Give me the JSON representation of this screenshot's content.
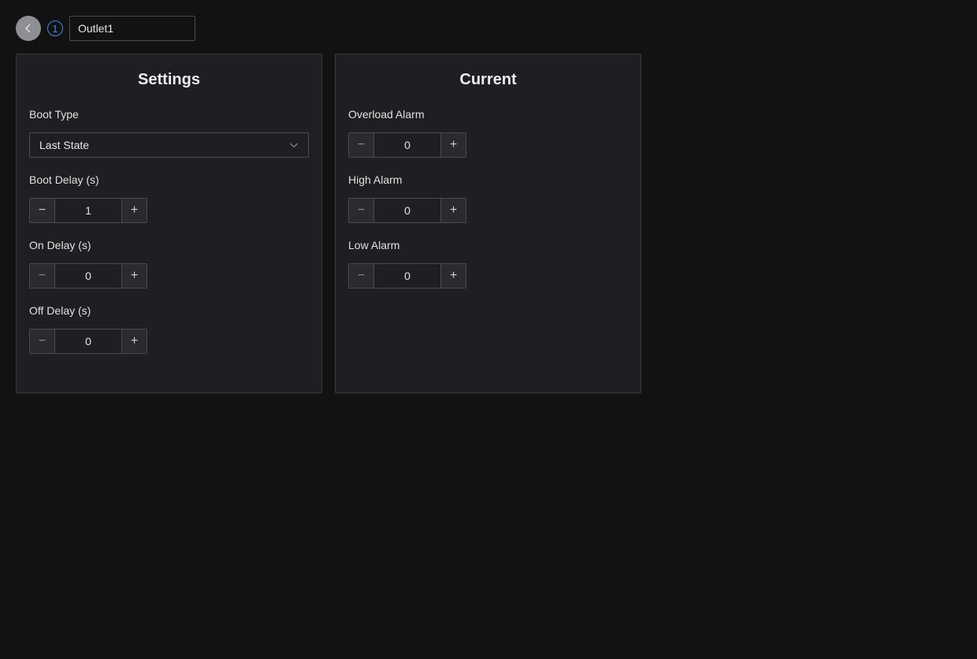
{
  "topbar": {
    "index": "1",
    "name_value": "Outlet1"
  },
  "settings": {
    "title": "Settings",
    "boot_type": {
      "label": "Boot Type",
      "value": "Last State"
    },
    "boot_delay": {
      "label": "Boot Delay (s)",
      "value": "1"
    },
    "on_delay": {
      "label": "On Delay (s)",
      "value": "0"
    },
    "off_delay": {
      "label": "Off Delay (s)",
      "value": "0"
    }
  },
  "current": {
    "title": "Current",
    "overload_alarm": {
      "label": "Overload Alarm",
      "value": "0"
    },
    "high_alarm": {
      "label": "High Alarm",
      "value": "0"
    },
    "low_alarm": {
      "label": "Low Alarm",
      "value": "0"
    }
  },
  "icons": {
    "back": "chevron-left-icon",
    "dropdown": "chevron-down-icon",
    "minus": "minus-icon",
    "plus": "plus-icon"
  },
  "colors": {
    "background": "#121212",
    "panel": "#1e1f22",
    "accent": "#3b8eea"
  }
}
